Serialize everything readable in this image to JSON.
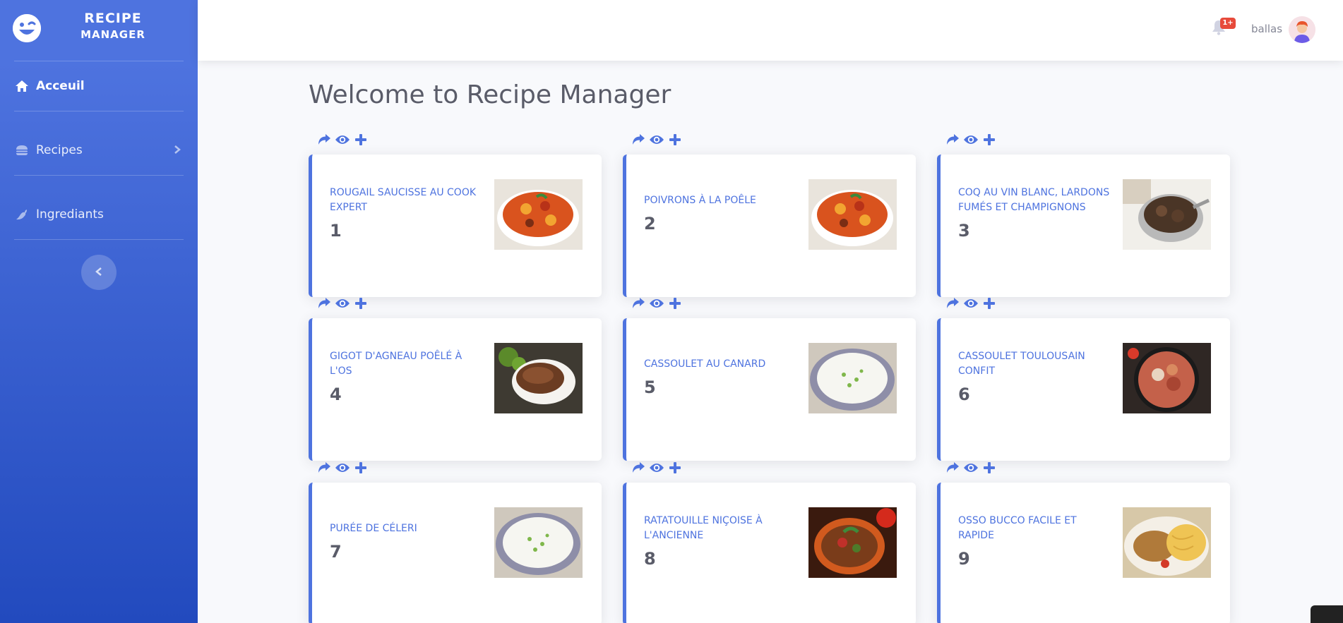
{
  "sidebar": {
    "brand": {
      "line1": "RECIPE",
      "line2": "MANAGER",
      "icon": "laugh-wink-icon"
    },
    "items": [
      {
        "label": "Acceuil",
        "icon": "home-icon",
        "active": true
      },
      {
        "label": "Recipes",
        "icon": "burger-icon",
        "active": false,
        "has_submenu": true
      },
      {
        "label": "Ingrediants",
        "icon": "pepper-icon",
        "active": false
      }
    ],
    "toggle_icon": "chevron-left-icon"
  },
  "topbar": {
    "notifications_badge": "1+",
    "user_name": "ballas"
  },
  "page": {
    "title": "Welcome to Recipe Manager"
  },
  "card_actions": [
    "share-icon",
    "eye-icon",
    "plus-icon"
  ],
  "recipes": [
    {
      "name": "ROUGAIL SAUCISSE AU COOK EXPERT",
      "id": "1",
      "image": "stew"
    },
    {
      "name": "POIVRONS À LA POÊLE",
      "id": "2",
      "image": "stew"
    },
    {
      "name": "COQ AU VIN BLANC, LARDONS FUMÉS ET CHAMPIGNONS",
      "id": "3",
      "image": "pot"
    },
    {
      "name": "GIGOT D'AGNEAU POÊLÉ À L'OS",
      "id": "4",
      "image": "meat"
    },
    {
      "name": "CASSOULET AU CANARD",
      "id": "5",
      "image": "rice"
    },
    {
      "name": "CASSOULET TOULOUSAIN CONFIT",
      "id": "6",
      "image": "pan"
    },
    {
      "name": "PURÉE DE CÉLERI",
      "id": "7",
      "image": "rice"
    },
    {
      "name": "RATATOUILLE NIÇOISE À L'ANCIENNE",
      "id": "8",
      "image": "ratatouille"
    },
    {
      "name": "OSSO BUCCO FACILE ET RAPIDE",
      "id": "9",
      "image": "pasta"
    }
  ],
  "colors": {
    "primary": "#4e73df",
    "primary_dark": "#224abe",
    "danger": "#e74a3b",
    "text": "#5a5c69"
  }
}
